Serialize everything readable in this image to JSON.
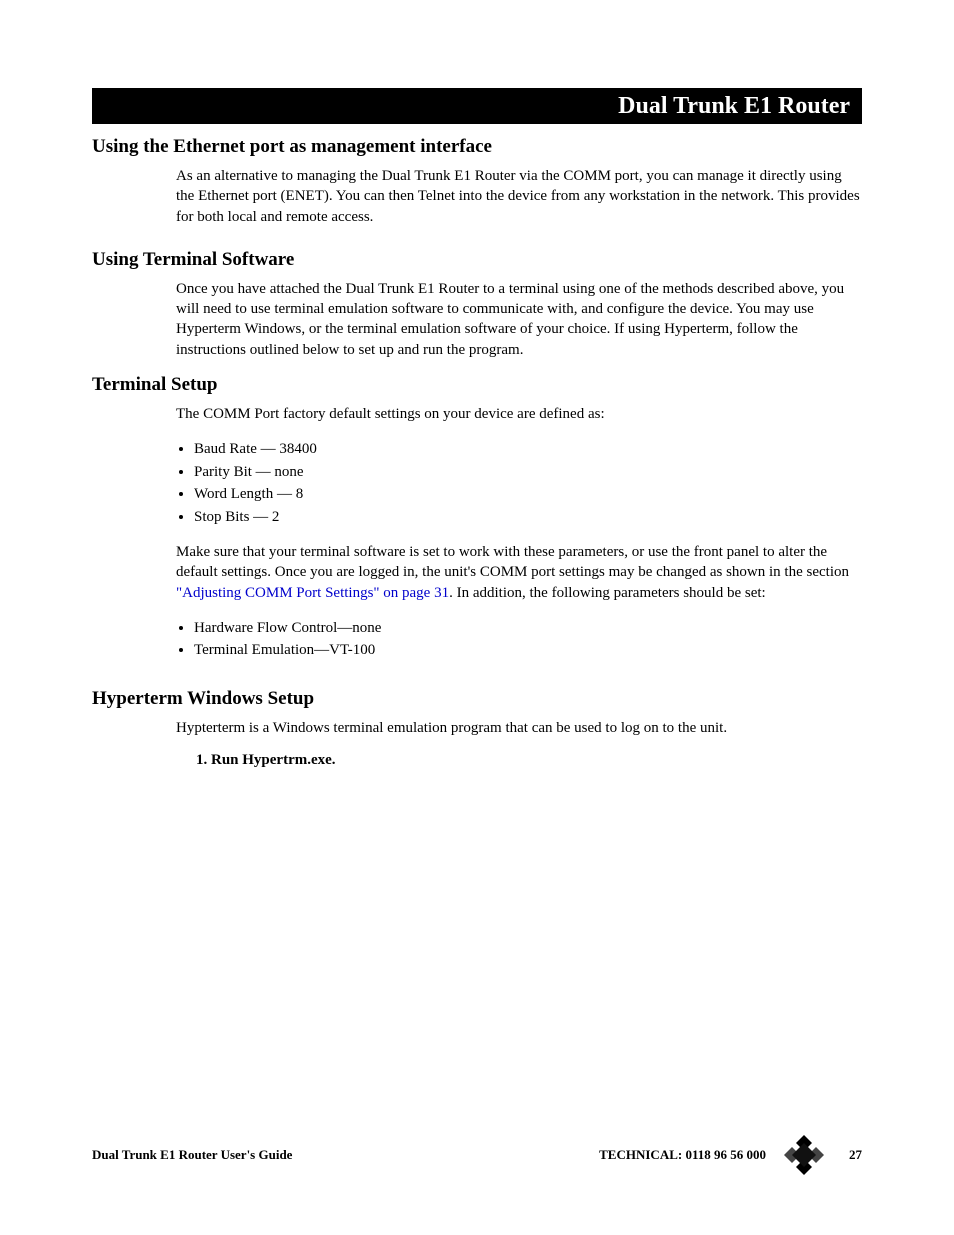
{
  "header": {
    "title": "Dual Trunk E1 Router"
  },
  "sections": {
    "s1": {
      "title": "Using the Ethernet port as management interface",
      "p1": "As an alternative to managing the Dual Trunk E1 Router via the COMM port, you can manage it directly using the Ethernet port (ENET). You can then Telnet into the device from any workstation in the network. This provides for both local and remote access."
    },
    "s2": {
      "title": "Using Terminal Software",
      "p1": "Once you have attached the Dual Trunk E1 Router to a terminal using one of the methods described above, you will need to use terminal emulation software to communicate with, and configure the device. You may use Hyperterm Windows, or the terminal emulation software of your choice. If using Hyperterm, follow the instructions outlined below to set up and run the program."
    },
    "s3": {
      "title": "Terminal Setup",
      "p1": "The COMM Port factory default settings on your device are defined as:",
      "bullets1": {
        "b0": "Baud Rate — 38400",
        "b1": "Parity Bit — none",
        "b2": "Word Length — 8",
        "b3": "Stop Bits — 2"
      },
      "p2_pre": "Make sure that your terminal software is set to work with these parameters, or use the front panel to alter the default settings. Once you are logged in, the unit's COMM port settings may be changed as shown in the section ",
      "p2_link": "\"Adjusting COMM Port Settings\" on page 31",
      "p2_post": ". In addition, the following parameters should be set:",
      "bullets2": {
        "b0": "Hardware Flow Control—none",
        "b1": "Terminal Emulation—VT-100"
      }
    },
    "s4": {
      "title": "Hyperterm Windows Setup",
      "p1": "Hypterterm is a Windows terminal emulation program that can be used to log on to the unit.",
      "step1": "1.  Run Hypertrm.exe."
    }
  },
  "footer": {
    "left": "Dual Trunk E1 Router User's Guide",
    "tech": "TECHNICAL: 0118 96 56 000",
    "page": "27"
  }
}
